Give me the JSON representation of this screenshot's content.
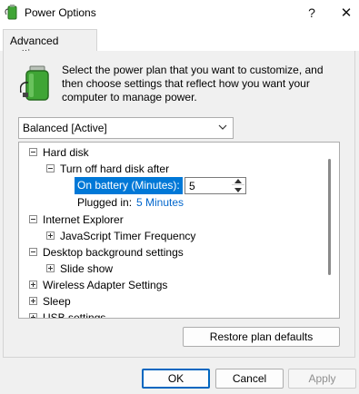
{
  "window": {
    "title": "Power Options",
    "help_glyph": "?",
    "close_glyph": "✕"
  },
  "tabs": [
    {
      "label": "Advanced settings"
    }
  ],
  "description": "Select the power plan that you want to customize, and then choose settings that reflect how you want your computer to manage power.",
  "plan_select": {
    "value": "Balanced [Active]"
  },
  "tree": {
    "items": [
      {
        "label": "Hard disk",
        "expander": "minus"
      },
      {
        "label": "Turn off hard disk after",
        "expander": "minus"
      },
      {
        "label": "On battery (Minutes):",
        "value": "5"
      },
      {
        "label": "Plugged in:",
        "value": "5 Minutes"
      },
      {
        "label": "Internet Explorer",
        "expander": "minus"
      },
      {
        "label": "JavaScript Timer Frequency",
        "expander": "plus"
      },
      {
        "label": "Desktop background settings",
        "expander": "minus"
      },
      {
        "label": "Slide show",
        "expander": "plus"
      },
      {
        "label": "Wireless Adapter Settings",
        "expander": "plus"
      },
      {
        "label": "Sleep",
        "expander": "plus"
      },
      {
        "label": "USB settings",
        "expander": "plus"
      }
    ]
  },
  "buttons": {
    "restore": "Restore plan defaults",
    "ok": "OK",
    "cancel": "Cancel",
    "apply": "Apply"
  },
  "colors": {
    "selection": "#0078d7",
    "link": "#0066cc",
    "battery_green": "#3fa535"
  }
}
